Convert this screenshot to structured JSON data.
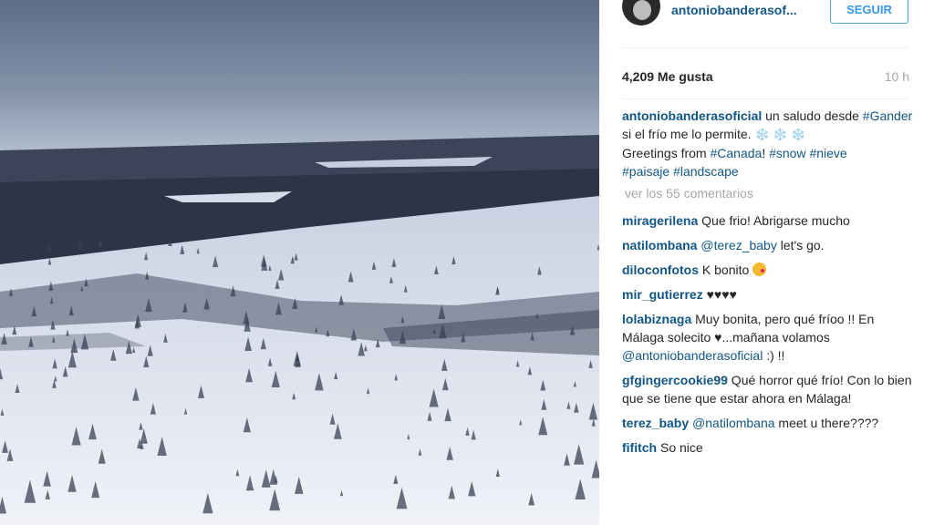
{
  "post": {
    "image_alt": "snowy landscape",
    "username": "antoniobanderasof...",
    "follow_label": "SEGUIR",
    "likes": "4,209 Me gusta",
    "time": "10 h",
    "caption": {
      "user": "antoniobanderasoficial",
      "t1": " un saludo desde ",
      "h1": "#Gander",
      "t2": " si el frío me lo permite. ",
      "flakes": "❄️ ❄️ ❄️",
      "t3": " Greetings from ",
      "h2": "#Canada",
      "t4": "! ",
      "h3": "#snow",
      "h4": "#nieve",
      "h5": "#paisaje",
      "h6": "#landscape"
    },
    "view_comments": "ver los 55 comentarios"
  },
  "comments": [
    {
      "user": "miragerilena",
      "text": " Que frio! Abrigarse mucho"
    },
    {
      "user": "natilombana",
      "mention": "@terez_baby",
      "text": " let's go."
    },
    {
      "user": "diloconfotos",
      "text": " K bonito "
    },
    {
      "user": "mir_gutierrez",
      "text": " ♥♥♥♥"
    },
    {
      "user": "lolabiznaga",
      "text": " Muy bonita, pero qué fríoo !! En Málaga solecito ♥...mañana volamos ",
      "mention": "@antoniobanderasoficial",
      "text2": " :) !!"
    },
    {
      "user": "gfgingercookie99",
      "text": " Qué horror qué frío! Con lo bien que se tiene que estar ahora en Málaga!"
    },
    {
      "user": "terez_baby",
      "mention": "@natilombana",
      "text": " meet u there????"
    },
    {
      "user": "fifitch",
      "text": " So nice"
    }
  ]
}
